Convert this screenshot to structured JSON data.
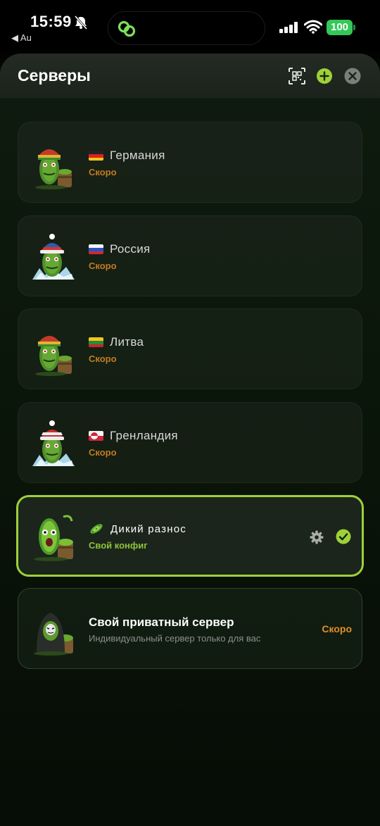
{
  "status_bar": {
    "time": "15:59",
    "back_app": "◀ Au",
    "battery": "100",
    "battery_color": "#34c759",
    "icons": [
      "bell-off-icon",
      "app-logo-icon",
      "signal-icon",
      "wifi-icon",
      "battery-icon"
    ]
  },
  "header": {
    "title": "Серверы",
    "icons": [
      "qr-scan-icon",
      "plus-icon",
      "close-icon"
    ],
    "accent": "#9ed03a"
  },
  "servers": [
    {
      "flag": "flag-de-icon",
      "name": "Германия",
      "status": "Скоро",
      "avatar": "cucumber-rasta-hat-avatar"
    },
    {
      "flag": "flag-ru-icon",
      "name": "Россия",
      "status": "Скоро",
      "avatar": "cucumber-winter-hat-avatar"
    },
    {
      "flag": "flag-lt-icon",
      "name": "Литва",
      "status": "Скоро",
      "avatar": "cucumber-rasta-hat-avatar"
    },
    {
      "flag": "flag-gl-icon",
      "name": "Гренландия",
      "status": "Скоро",
      "avatar": "cucumber-winter-hat-avatar"
    }
  ],
  "active_server": {
    "icon": "cucumber-icon",
    "name": "Дикий разнос",
    "status": "Свой конфиг",
    "avatar": "cucumber-screaming-avatar",
    "selected": true
  },
  "private_server": {
    "title": "Свой приватный сервер",
    "subtitle": "Индивидуальный сервер только для вас",
    "status": "Скоро",
    "avatar": "cucumber-hooded-avatar"
  },
  "colors": {
    "soon": "#c27b22",
    "own_config": "#8fc43a",
    "active_border": "#9ed03a"
  }
}
